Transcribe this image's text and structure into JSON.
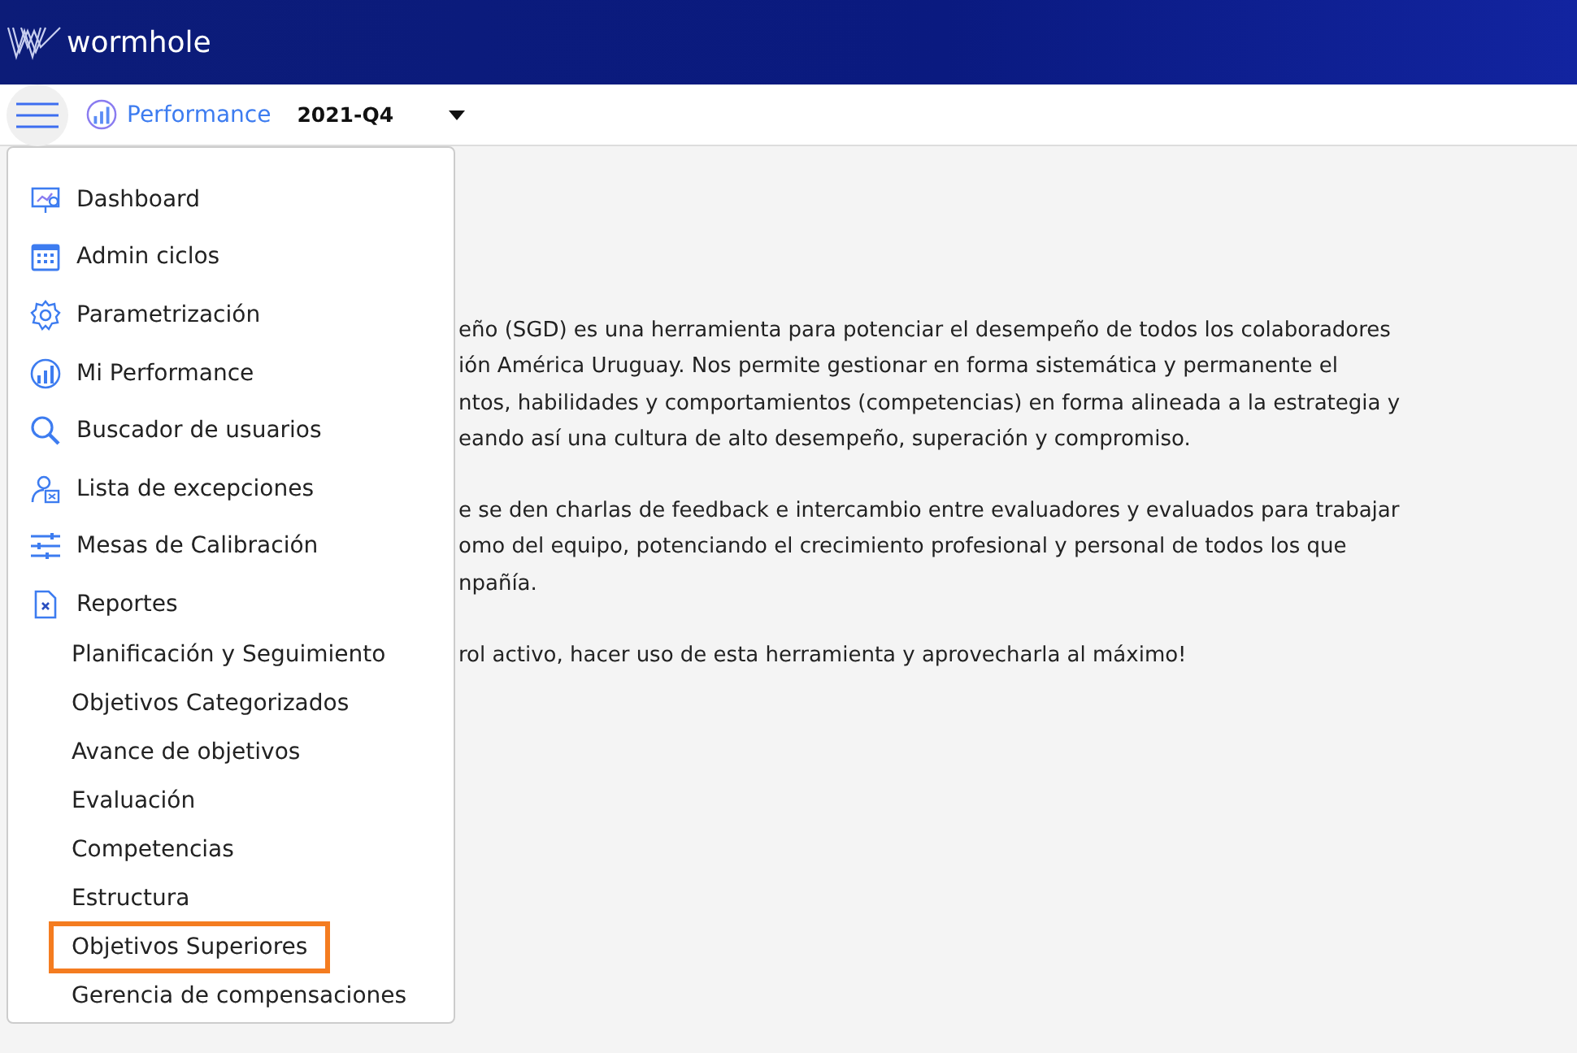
{
  "brand": {
    "name": "wormhole"
  },
  "toolbar": {
    "module": "Performance",
    "period": "2021-Q4"
  },
  "menu": {
    "items": [
      {
        "label": "Dashboard"
      },
      {
        "label": "Admin ciclos"
      },
      {
        "label": "Parametrización"
      },
      {
        "label": "Mi Performance"
      },
      {
        "label": "Buscador de usuarios"
      },
      {
        "label": "Lista de excepciones"
      },
      {
        "label": "Mesas de Calibración"
      },
      {
        "label": "Reportes",
        "children": [
          {
            "label": "Planificación y Seguimiento",
            "selected": false
          },
          {
            "label": "Objetivos Categorizados",
            "selected": false
          },
          {
            "label": "Avance de objetivos",
            "selected": false
          },
          {
            "label": "Evaluación",
            "selected": false
          },
          {
            "label": "Competencias",
            "selected": false
          },
          {
            "label": "Estructura",
            "selected": false
          },
          {
            "label": "Objetivos Superiores",
            "selected": true
          },
          {
            "label": "Gerencia de compensaciones",
            "selected": false
          }
        ]
      }
    ]
  },
  "content": {
    "paragraphs": [
      [
        "eño (SGD) es una herramienta para potenciar el desempeño de todos los colaboradores",
        "ión América Uruguay. Nos permite gestionar en forma sistemática y permanente el",
        "ntos, habilidades y comportamientos (competencias) en forma alineada a la estrategia y",
        "eando así una cultura de alto desempeño, superación y compromiso."
      ],
      [
        "e se den charlas de feedback e intercambio entre evaluadores y evaluados para trabajar",
        "omo del equipo, potenciando el crecimiento profesional y personal de todos los que",
        "npañía."
      ],
      [
        "rol activo, hacer uso de esta herramienta y aprovecharla al máximo!"
      ]
    ]
  }
}
